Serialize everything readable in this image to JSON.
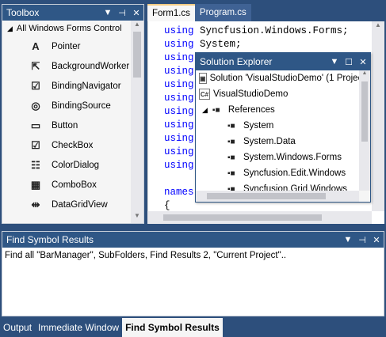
{
  "toolbox": {
    "title": "Toolbox",
    "group": "All Windows Forms Control",
    "items": [
      {
        "label": "Pointer",
        "icon": "pointer-icon",
        "glyph": "A"
      },
      {
        "label": "BackgroundWorker",
        "icon": "background-worker-icon",
        "glyph": "⇱"
      },
      {
        "label": "BindingNavigator",
        "icon": "binding-navigator-icon",
        "glyph": "☑"
      },
      {
        "label": "BindingSource",
        "icon": "binding-source-icon",
        "glyph": "◎"
      },
      {
        "label": "Button",
        "icon": "button-icon",
        "glyph": "▭"
      },
      {
        "label": "CheckBox",
        "icon": "checkbox-icon",
        "glyph": "☑"
      },
      {
        "label": "ColorDialog",
        "icon": "color-dialog-icon",
        "glyph": "☷"
      },
      {
        "label": "ComboBox",
        "icon": "combobox-icon",
        "glyph": "▦"
      },
      {
        "label": "DataGridView",
        "icon": "datagridview-icon",
        "glyph": "⇹"
      }
    ]
  },
  "editor": {
    "tabs": [
      {
        "label": "Form1.cs",
        "active": true
      },
      {
        "label": "Program.cs",
        "active": false
      }
    ],
    "lines": [
      {
        "kw": "using",
        "rest": " Syncfusion.Windows.Forms;"
      },
      {
        "kw": "using",
        "rest": " System;"
      },
      {
        "kw": "using",
        "rest": ""
      },
      {
        "kw": "using",
        "rest": ""
      },
      {
        "kw": "using",
        "rest": ""
      },
      {
        "kw": "using",
        "rest": ""
      },
      {
        "kw": "using",
        "rest": ""
      },
      {
        "kw": "using",
        "rest": ""
      },
      {
        "kw": "using",
        "rest": ""
      },
      {
        "kw": "using",
        "rest": ""
      },
      {
        "kw": "using",
        "rest": ""
      },
      {
        "kw": "",
        "rest": ""
      },
      {
        "kw": "names",
        "rest": ""
      },
      {
        "kw": "",
        "rest": "{"
      }
    ]
  },
  "solution_explorer": {
    "title": "Solution Explorer",
    "solution": "Solution 'VisualStudioDemo' (1 Projec",
    "project": "VisualStudioDemo",
    "references_label": "References",
    "references": [
      "System",
      "System.Data",
      "System.Windows.Forms",
      "Syncfusion.Edit.Windows",
      "Syncfusion.Grid.Windows"
    ]
  },
  "results": {
    "title": "Find Symbol Results",
    "line": "Find all \"BarManager\", SubFolders, Find Results 2, \"Current Project\".."
  },
  "bottom_tabs": [
    {
      "label": "Output",
      "active": false
    },
    {
      "label": "Immediate Window",
      "active": false
    },
    {
      "label": "Find Symbol Results",
      "active": true
    }
  ],
  "pane_buttons": {
    "dropdown": "▼",
    "pin": "⊣",
    "close": "✕",
    "maximize": "☐"
  }
}
